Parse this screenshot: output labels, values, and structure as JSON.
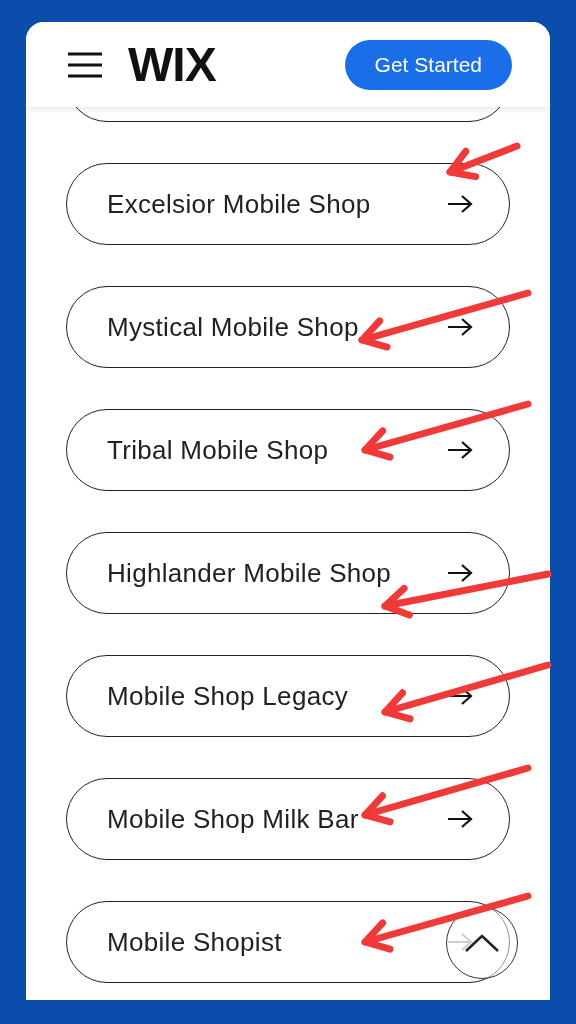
{
  "header": {
    "logo": "WIX",
    "button": "Get Started"
  },
  "shops": [
    {
      "label": "Excelsior Mobile Shop"
    },
    {
      "label": "Mystical Mobile Shop"
    },
    {
      "label": "Tribal Mobile Shop"
    },
    {
      "label": "Highlander Mobile Shop"
    },
    {
      "label": "Mobile Shop Legacy"
    },
    {
      "label": "Mobile Shop Milk Bar"
    },
    {
      "label": "Mobile Shopist"
    }
  ]
}
